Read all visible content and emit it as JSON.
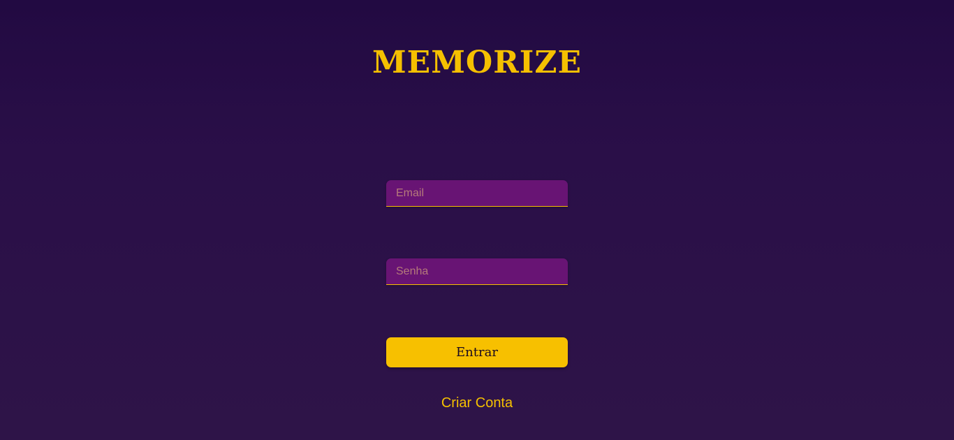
{
  "app": {
    "logo_text": "MEMORIZE"
  },
  "login_form": {
    "email": {
      "placeholder": "Email",
      "value": ""
    },
    "password": {
      "placeholder": "Senha",
      "value": ""
    },
    "submit_label": "Entrar",
    "create_account_label": "Criar Conta"
  },
  "colors": {
    "background_top": "#220a42",
    "background_bottom": "#2e1448",
    "accent": "#f5c000",
    "field_background": "#681474",
    "placeholder": "#b57a7a"
  }
}
